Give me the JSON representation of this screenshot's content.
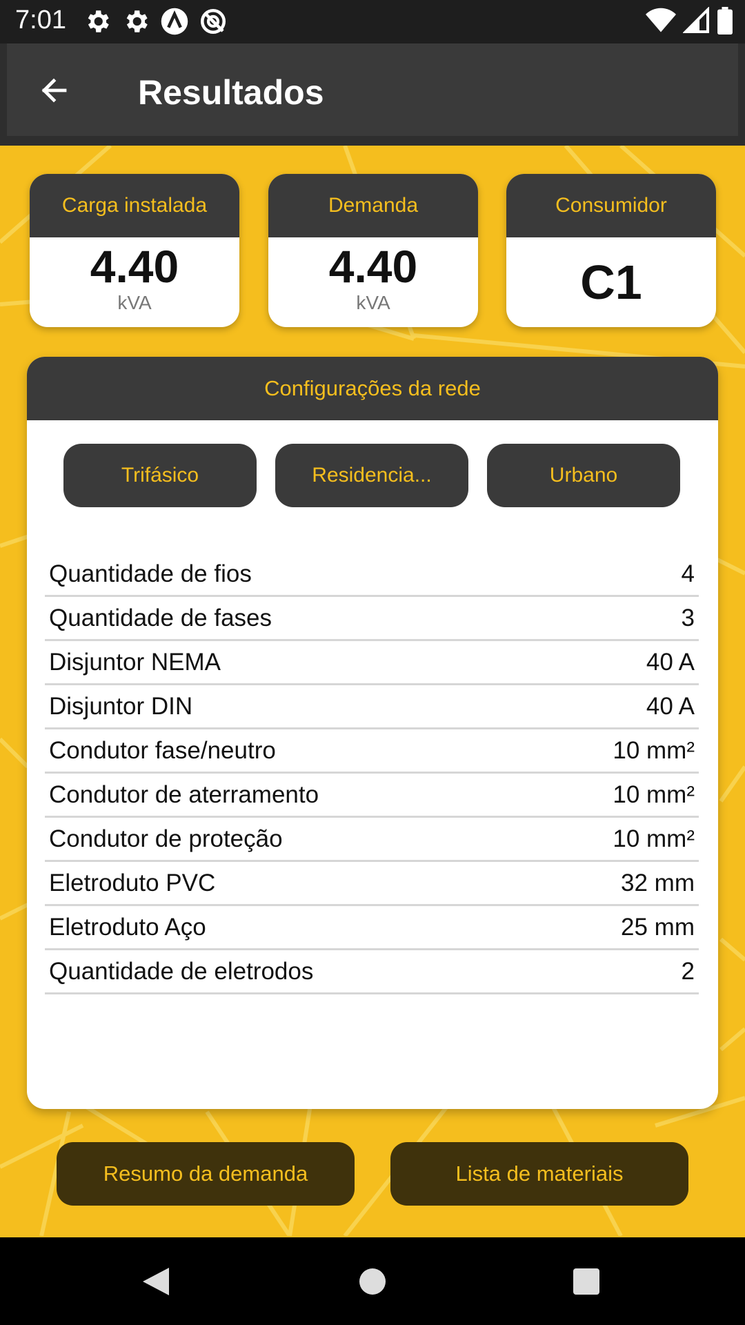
{
  "status_bar": {
    "time": "7:01",
    "left_icons": [
      "gear-icon",
      "gear-icon",
      "a-circle-icon",
      "no-sync-icon"
    ],
    "right_icons": [
      "wifi-icon",
      "signal-icon",
      "battery-icon"
    ]
  },
  "app_bar": {
    "title": "Resultados",
    "back_icon": "arrow-left-icon"
  },
  "cards": [
    {
      "label": "Carga instalada",
      "value": "4.40",
      "unit": "kVA"
    },
    {
      "label": "Demanda",
      "value": "4.40",
      "unit": "kVA"
    },
    {
      "label": "Consumidor",
      "value": "C1"
    }
  ],
  "config": {
    "title": "Configurações da rede",
    "chips": [
      "Trifásico",
      "Residencia...",
      "Urbano"
    ],
    "rows": [
      {
        "label": "Quantidade de fios",
        "value": "4"
      },
      {
        "label": "Quantidade de fases",
        "value": "3"
      },
      {
        "label": "Disjuntor NEMA",
        "value": "40 A"
      },
      {
        "label": "Disjuntor DIN",
        "value": "40 A"
      },
      {
        "label": "Condutor fase/neutro",
        "value": "10 mm²"
      },
      {
        "label": "Condutor de aterramento",
        "value": "10 mm²"
      },
      {
        "label": "Condutor de proteção",
        "value": "10 mm²"
      },
      {
        "label": "Eletroduto PVC",
        "value": "32 mm"
      },
      {
        "label": "Eletroduto Aço",
        "value": "25 mm"
      },
      {
        "label": "Quantidade de eletrodos",
        "value": "2"
      }
    ]
  },
  "buttons": {
    "summary": "Resumo da demanda",
    "materials": "Lista de materiais"
  },
  "colors": {
    "accent": "#F5BE1E",
    "dark": "#3A3A3A",
    "button_dark": "#3F320C"
  },
  "nav_bar": [
    "back-triangle-icon",
    "home-circle-icon",
    "recents-square-icon"
  ]
}
